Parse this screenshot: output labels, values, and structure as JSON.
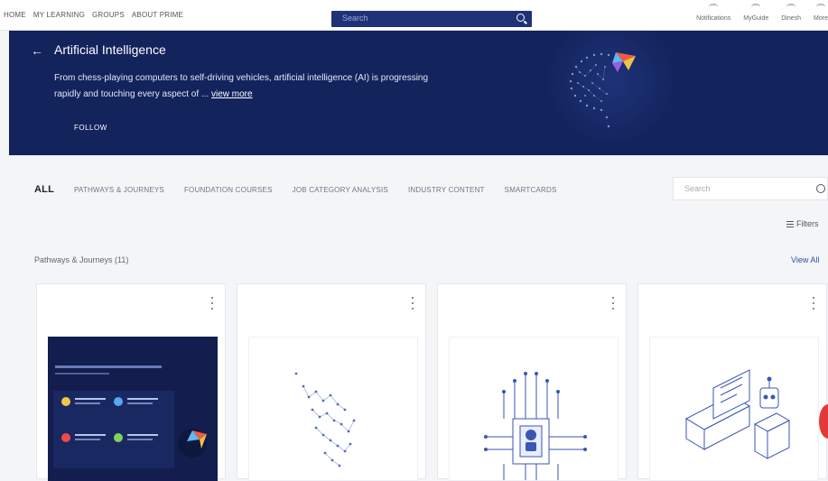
{
  "nav": {
    "links": [
      "HOME",
      "MY LEARNING",
      "GROUPS",
      "ABOUT PRIME"
    ],
    "search_placeholder": "Search",
    "right": [
      "Notifications",
      "MyGuide",
      "Dinesh",
      "More"
    ]
  },
  "hero": {
    "title": "Artificial Intelligence",
    "description": "From chess-playing computers to self-driving vehicles, artificial intelligence (AI) is progressing rapidly and touching every aspect of ...",
    "view_more": "view more",
    "follow": "FOLLOW"
  },
  "tabs": [
    "ALL",
    "PATHWAYS & JOURNEYS",
    "FOUNDATION COURSES",
    "JOB CATEGORY ANALYSIS",
    "INDUSTRY CONTENT",
    "SMARTCARDS"
  ],
  "filter_search_placeholder": "Search",
  "filters_label": "Filters",
  "section": {
    "label": "Pathways & Journeys (11)",
    "view_all": "View All"
  },
  "colors": {
    "brand_navy": "#13235c",
    "accent_blue": "#1f3277",
    "link": "#2a4fa8",
    "badge_red": "#e23a3a"
  }
}
